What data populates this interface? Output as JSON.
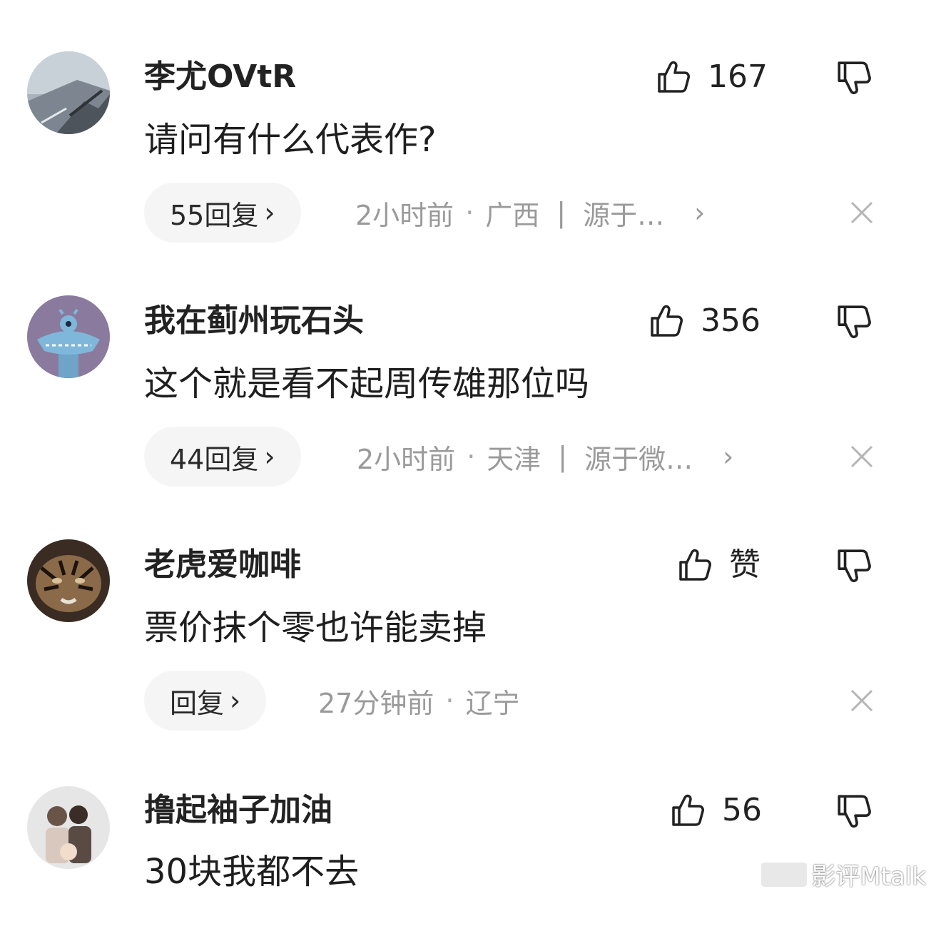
{
  "comments": [
    {
      "username": "李尤OVtR",
      "likes": "167",
      "text": "请问有什么代表作?",
      "reply": "55回复",
      "time": "2小时前",
      "location": "广西",
      "source": "源于…"
    },
    {
      "username": "我在蓟州玩石头",
      "likes": "356",
      "text": "这个就是看不起周传雄那位吗",
      "reply": "44回复",
      "time": "2小时前",
      "location": "天津",
      "source": "源于微…"
    },
    {
      "username": "老虎爱咖啡",
      "likes": "赞",
      "text": "票价抹个零也许能卖掉",
      "reply": "回复",
      "time": "27分钟前",
      "location": "辽宁"
    },
    {
      "username": "撸起袖子加油",
      "likes": "56",
      "text": "30块我都不去"
    }
  ],
  "watermark": "影评Mtalk",
  "icons": {
    "like": "thumbs-up-icon",
    "dislike": "thumbs-down-icon",
    "close": "close-icon",
    "chevron": "chevron-right-icon"
  }
}
